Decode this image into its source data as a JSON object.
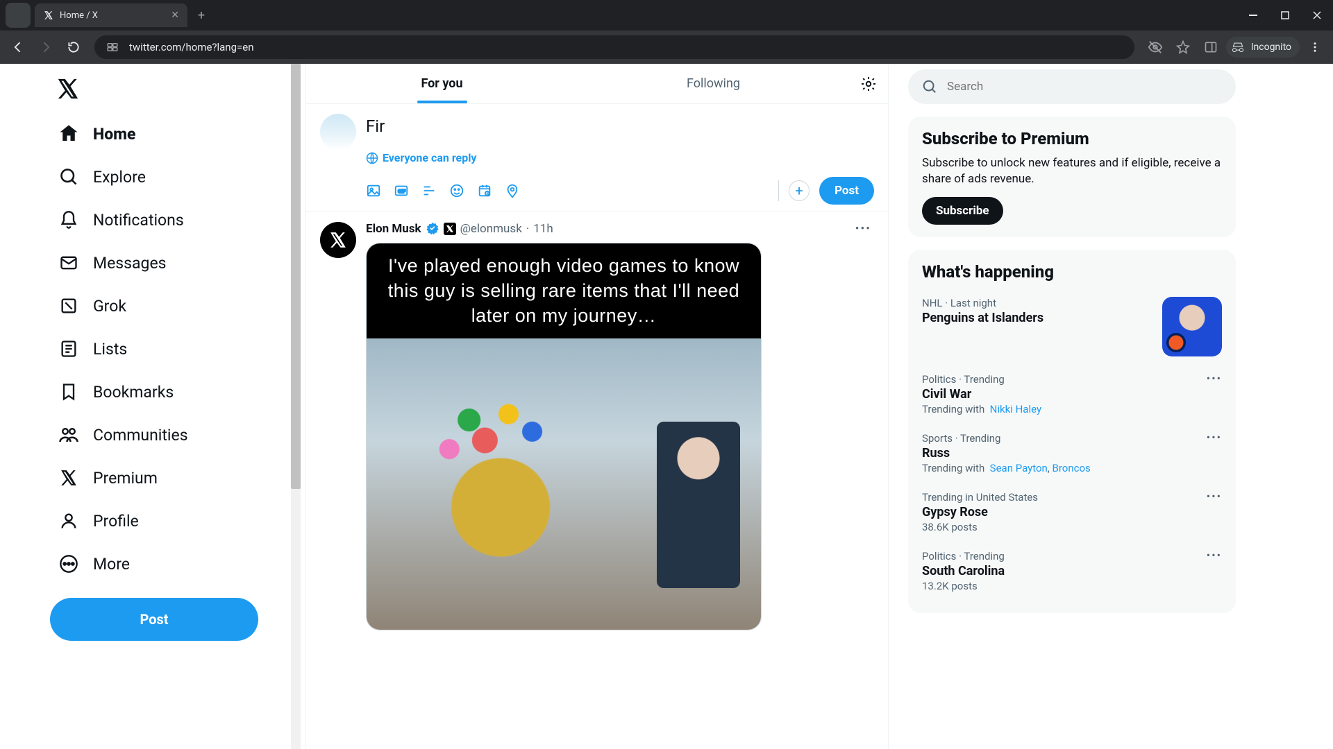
{
  "browser": {
    "tab_title": "Home / X",
    "url": "twitter.com/home?lang=en",
    "incognito_label": "Incognito"
  },
  "nav": {
    "home": "Home",
    "explore": "Explore",
    "notifications": "Notifications",
    "messages": "Messages",
    "grok": "Grok",
    "lists": "Lists",
    "bookmarks": "Bookmarks",
    "communities": "Communities",
    "premium": "Premium",
    "profile": "Profile",
    "more": "More",
    "post": "Post"
  },
  "feed": {
    "tab_foryou": "For you",
    "tab_following": "Following"
  },
  "composer": {
    "value": "Fir",
    "reply_scope": "Everyone can reply",
    "post": "Post"
  },
  "tweet": {
    "name": "Elon Musk",
    "handle": "@elonmusk",
    "time": "11h",
    "meme_text": "I've played enough video games to know this guy is selling rare items that I'll need later on my journey…"
  },
  "search": {
    "placeholder": "Search"
  },
  "premium": {
    "heading": "Subscribe to Premium",
    "body": "Subscribe to unlock new features and if eligible, receive a share of ads revenue.",
    "cta": "Subscribe"
  },
  "happening": {
    "heading": "What's happening",
    "items": [
      {
        "meta": "NHL · Last night",
        "title": "Penguins at Islanders",
        "thumb": true
      },
      {
        "meta": "Politics · Trending",
        "title": "Civil War",
        "with_prefix": "Trending with",
        "with_links": [
          "Nikki Haley"
        ]
      },
      {
        "meta": "Sports · Trending",
        "title": "Russ",
        "with_prefix": "Trending with",
        "with_links": [
          "Sean Payton",
          "Broncos"
        ]
      },
      {
        "meta": "Trending in United States",
        "title": "Gypsy Rose",
        "sub": "38.6K posts"
      },
      {
        "meta": "Politics · Trending",
        "title": "South Carolina",
        "sub": "13.2K posts"
      }
    ]
  }
}
